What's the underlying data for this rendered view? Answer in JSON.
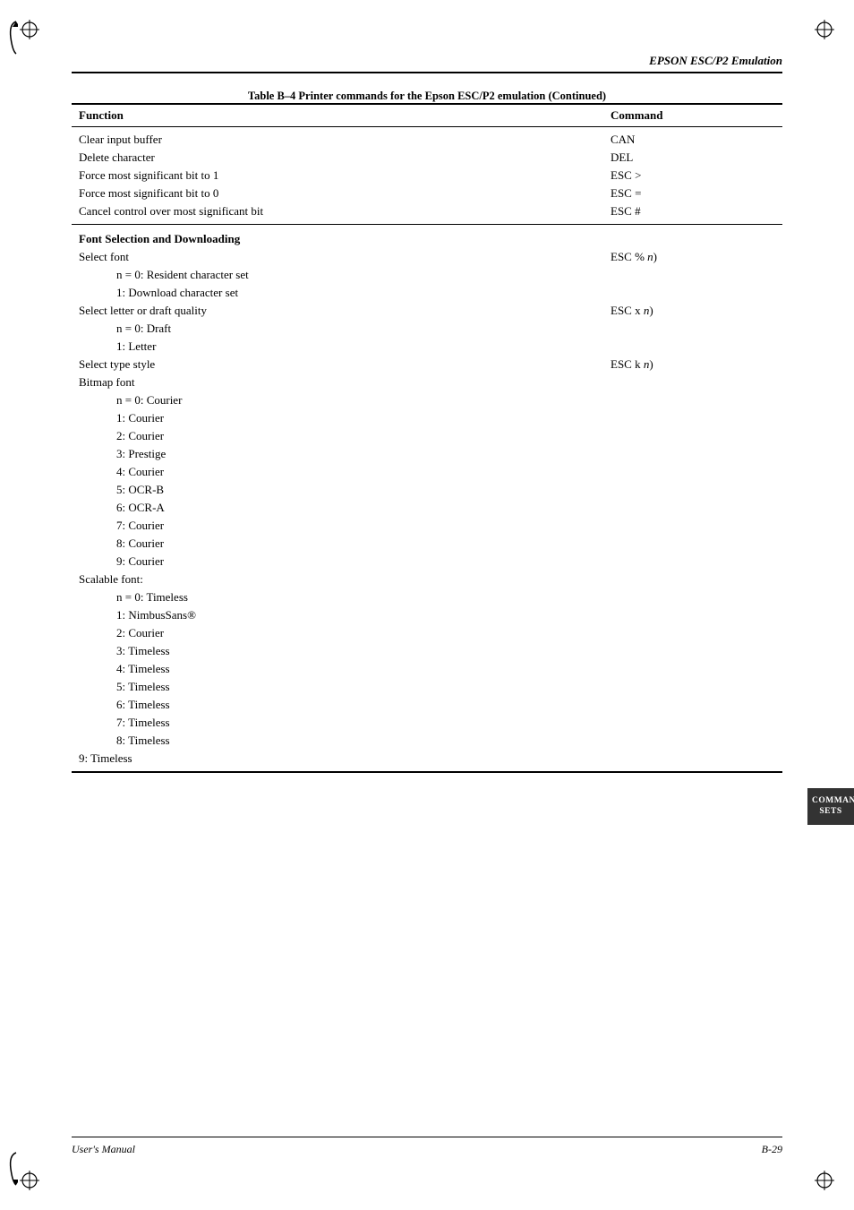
{
  "header": {
    "title": "EPSON ESC/P2 Emulation"
  },
  "table_caption": "Table B–4    Printer commands for the Epson ESC/P2 emulation (Continued)",
  "table_headers": {
    "function": "Function",
    "command": "Command"
  },
  "rows": [
    {
      "type": "top-border",
      "function": "Clear input buffer",
      "command": "CAN"
    },
    {
      "type": "normal",
      "function": "Delete character",
      "command": "DEL"
    },
    {
      "type": "normal",
      "function": "Force most significant bit to 1",
      "command": "ESC >"
    },
    {
      "type": "normal",
      "function": "Force most significant bit to 0",
      "command": "ESC ="
    },
    {
      "type": "normal-border",
      "function": "Cancel control over most significant bit",
      "command": "ESC #"
    },
    {
      "type": "section-header",
      "function": "Font Selection and Downloading",
      "command": ""
    },
    {
      "type": "normal",
      "function": "Select font",
      "command": "ESC % (n)"
    },
    {
      "type": "indent1",
      "function": "n = 0:   Resident character set",
      "command": ""
    },
    {
      "type": "indent1",
      "function": "1:   Download character set",
      "command": ""
    },
    {
      "type": "normal",
      "function": "Select letter or draft quality",
      "command": "ESC x (n)"
    },
    {
      "type": "indent1",
      "function": "n = 0:   Draft",
      "command": ""
    },
    {
      "type": "indent1",
      "function": "1:   Letter",
      "command": ""
    },
    {
      "type": "normal",
      "function": "Select type style",
      "command": "ESC k (n)"
    },
    {
      "type": "normal",
      "function": "Bitmap font",
      "command": ""
    },
    {
      "type": "indent1",
      "function": "n = 0:   Courier",
      "command": ""
    },
    {
      "type": "indent1",
      "function": "1:   Courier",
      "command": ""
    },
    {
      "type": "indent1",
      "function": "2:   Courier",
      "command": ""
    },
    {
      "type": "indent1",
      "function": "3:   Prestige",
      "command": ""
    },
    {
      "type": "indent1",
      "function": "4:   Courier",
      "command": ""
    },
    {
      "type": "indent1",
      "function": "5:   OCR-B",
      "command": ""
    },
    {
      "type": "indent1",
      "function": "6:   OCR-A",
      "command": ""
    },
    {
      "type": "indent1",
      "function": "7:   Courier",
      "command": ""
    },
    {
      "type": "indent1",
      "function": "8:   Courier",
      "command": ""
    },
    {
      "type": "indent1",
      "function": "9:   Courier",
      "command": ""
    },
    {
      "type": "normal",
      "function": "Scalable font:",
      "command": ""
    },
    {
      "type": "indent1",
      "function": "n = 0:   Timeless",
      "command": ""
    },
    {
      "type": "indent1",
      "function": "1:   NimbusSans®",
      "command": ""
    },
    {
      "type": "indent1",
      "function": "2:   Courier",
      "command": ""
    },
    {
      "type": "indent1",
      "function": "3:   Timeless",
      "command": ""
    },
    {
      "type": "indent1",
      "function": "4:   Timeless",
      "command": ""
    },
    {
      "type": "indent1",
      "function": "5:   Timeless",
      "command": ""
    },
    {
      "type": "indent1",
      "function": "6:   Timeless",
      "command": ""
    },
    {
      "type": "indent1",
      "function": "7:   Timeless",
      "command": ""
    },
    {
      "type": "indent1",
      "function": "8:   Timeless",
      "command": ""
    },
    {
      "type": "last-row",
      "function": "9:   Timeless",
      "command": ""
    }
  ],
  "side_tab": {
    "line1": "COMMAND",
    "line2": "SETS"
  },
  "footer": {
    "left": "User's Manual",
    "right": "B-29"
  }
}
